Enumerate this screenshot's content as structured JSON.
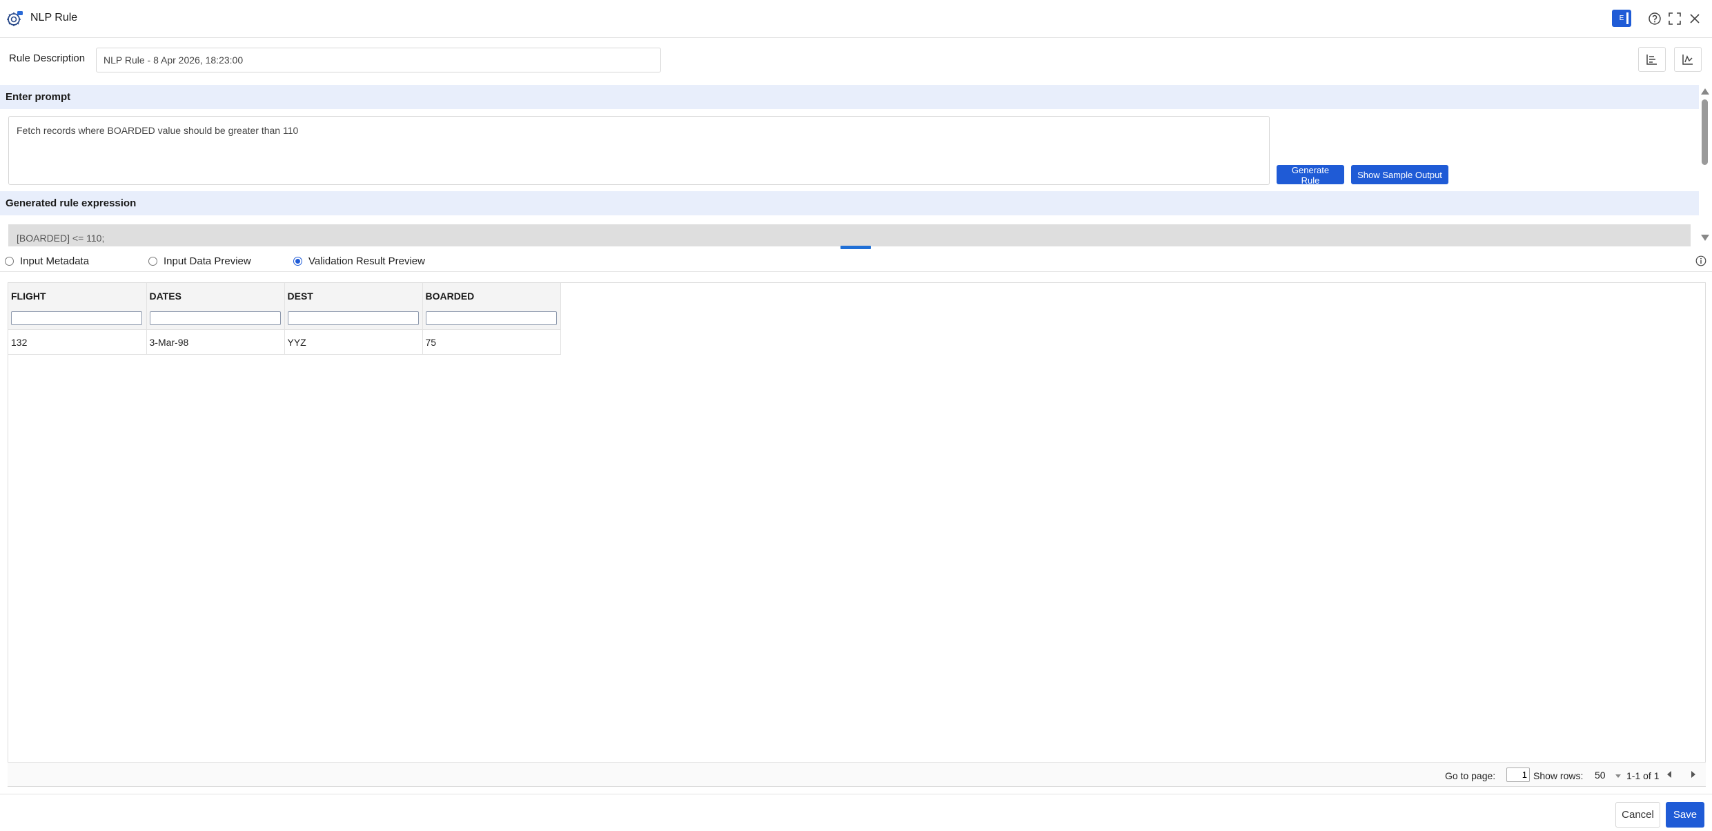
{
  "app": {
    "title": "NLP Rule",
    "user_initial": "E"
  },
  "rule": {
    "description_label": "Rule Description",
    "description_value": "NLP Rule - 8 Apr 2026, 18:23:00"
  },
  "prompt": {
    "heading": "Enter prompt",
    "text": "Fetch records where BOARDED value should be greater than 110",
    "generate_label": "Generate Rule",
    "sample_label": "Show Sample Output"
  },
  "expression": {
    "heading": "Generated rule expression",
    "text": "[BOARDED] <= 110;"
  },
  "preview_tabs": [
    {
      "label": "Input Metadata",
      "selected": false
    },
    {
      "label": "Input Data Preview",
      "selected": false
    },
    {
      "label": "Validation Result Preview",
      "selected": true
    }
  ],
  "grid": {
    "columns": [
      "FLIGHT",
      "DATES",
      "DEST",
      "BOARDED"
    ],
    "rows": [
      [
        "132",
        "3-Mar-98",
        "YYZ",
        "75"
      ]
    ]
  },
  "pager": {
    "go_to_label": "Go to page:",
    "page": "1",
    "show_rows_label": "Show rows:",
    "rows_per_page": "50",
    "range": "1-1 of 1"
  },
  "footer": {
    "cancel_label": "Cancel",
    "save_label": "Save"
  },
  "colors": {
    "primary": "#1f5bd6",
    "section_bg": "#e8eefb"
  }
}
